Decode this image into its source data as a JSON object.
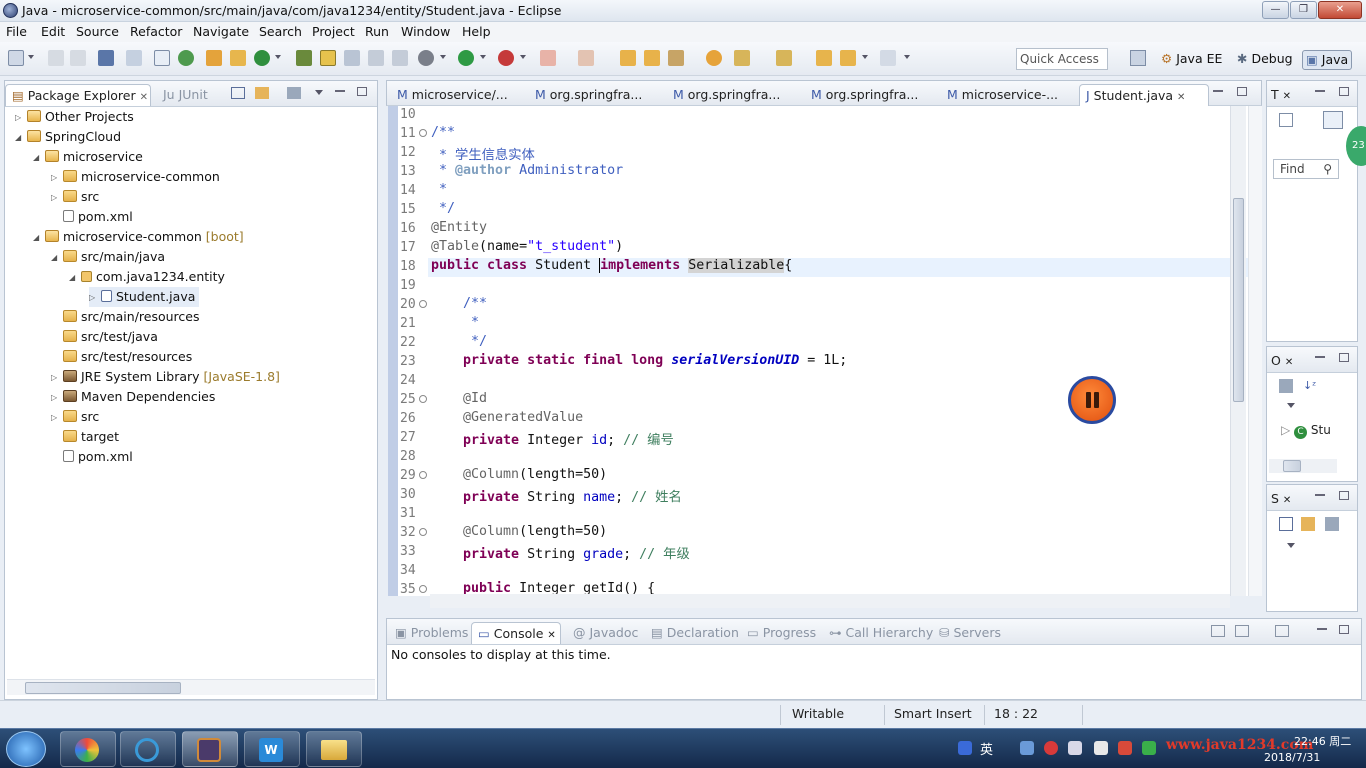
{
  "window": {
    "title": "Java - microservice-common/src/main/java/com/java1234/entity/Student.java - Eclipse"
  },
  "menu": [
    "File",
    "Edit",
    "Source",
    "Refactor",
    "Navigate",
    "Search",
    "Project",
    "Run",
    "Window",
    "Help"
  ],
  "quick_access": "Quick Access",
  "perspectives": [
    "Java EE",
    "Debug",
    "Java"
  ],
  "left_tabs": {
    "package_explorer": "Package Explorer",
    "junit": "JUnit"
  },
  "tree": [
    {
      "label": "Other Projects",
      "deco": ""
    },
    {
      "label": "SpringCloud",
      "deco": ""
    },
    {
      "label": "microservice",
      "deco": ""
    },
    {
      "label": "microservice-common",
      "deco": ""
    },
    {
      "label": "src",
      "deco": ""
    },
    {
      "label": "pom.xml",
      "deco": ""
    },
    {
      "label": "microservice-common",
      "deco": "[boot]"
    },
    {
      "label": "src/main/java",
      "deco": ""
    },
    {
      "label": "com.java1234.entity",
      "deco": ""
    },
    {
      "label": "Student.java",
      "deco": ""
    },
    {
      "label": "src/main/resources",
      "deco": ""
    },
    {
      "label": "src/test/java",
      "deco": ""
    },
    {
      "label": "src/test/resources",
      "deco": ""
    },
    {
      "label": "JRE System Library",
      "deco": "[JavaSE-1.8]"
    },
    {
      "label": "Maven Dependencies",
      "deco": ""
    },
    {
      "label": "src",
      "deco": ""
    },
    {
      "label": "target",
      "deco": ""
    },
    {
      "label": "pom.xml",
      "deco": ""
    }
  ],
  "editor_tabs": [
    "microservice/...",
    "org.springfra...",
    "org.springfra...",
    "org.springfra...",
    "microservice-...",
    "Student.java"
  ],
  "code": {
    "line_numbers": [
      "10",
      "11",
      "12",
      "13",
      "14",
      "15",
      "16",
      "17",
      "18",
      "19",
      "20",
      "21",
      "22",
      "23",
      "24",
      "25",
      "26",
      "27",
      "28",
      "29",
      "30",
      "31",
      "32",
      "33",
      "34",
      "35"
    ],
    "l11": "/**",
    "l12": " * 学生信息实体",
    "l13_a": " * ",
    "l13_b": "@author",
    "l13_c": " Administrator",
    "l14": " *",
    "l15": " */",
    "l16": "@Entity",
    "l17_a": "@Table",
    "l17_b": "(name=",
    "l17_c": "\"t_student\"",
    "l17_d": ")",
    "l18_a": "public class",
    "l18_b": " Student ",
    "l18_c": "implements",
    "l18_d": "Serializable",
    "l18_e": "{",
    "l20": "    /**",
    "l21": "     *",
    "l22": "     */",
    "l23_a": "    private static final long",
    "l23_b": "serialVersionUID",
    "l23_c": " = 1L;",
    "l25": "    @Id",
    "l26": "    @GeneratedValue",
    "l27_a": "    private",
    "l27_b": " Integer ",
    "l27_c": "id",
    "l27_d": "; ",
    "l27_e": "// 编号",
    "l29_a": "    @Column",
    "l29_b": "(length=50)",
    "l30_a": "    private",
    "l30_b": " String ",
    "l30_c": "name",
    "l30_d": "; ",
    "l30_e": "// 姓名",
    "l32_a": "    @Column",
    "l32_b": "(length=50)",
    "l33_a": "    private",
    "l33_b": " String ",
    "l33_c": "grade",
    "l33_d": "; ",
    "l33_e": "// 年级",
    "l35_a": "    public",
    "l35_b": " Integer getId() {"
  },
  "bottom_tabs": [
    "Problems",
    "Console",
    "Javadoc",
    "Declaration",
    "Progress",
    "Call Hierarchy",
    "Servers"
  ],
  "console_message": "No consoles to display at this time.",
  "right_panels": {
    "task_tab": "T",
    "find_label": "Find",
    "outline_tab": "O",
    "outline_item": "Stu",
    "s_tab": "S",
    "badge": "23"
  },
  "status": {
    "writable": "Writable",
    "insert_mode": "Smart Insert",
    "position": "18 : 22"
  },
  "taskbar": {
    "ime": "英",
    "watermark": "www.java1234.com",
    "time": "22:46 周二",
    "date": "2018/7/31"
  },
  "colors": {
    "keyword": "#7f0055",
    "comment": "#3f5fbf",
    "string": "#2a00ff",
    "field": "#0000c0"
  }
}
